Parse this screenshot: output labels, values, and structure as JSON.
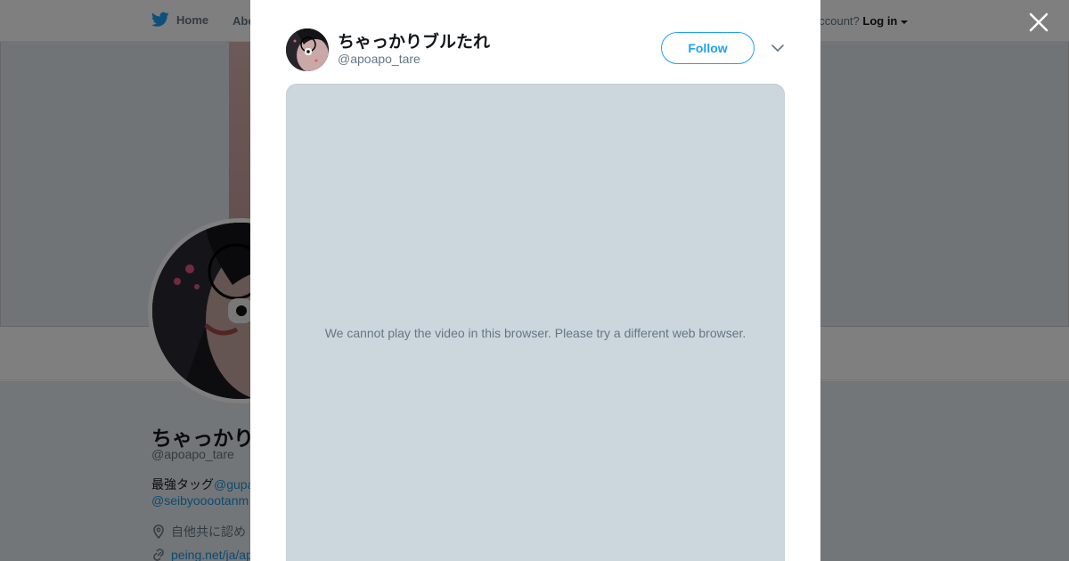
{
  "topbar": {
    "home_label": "Home",
    "about_label": "Abo",
    "login_prefix": "account?",
    "login_label": "Log in"
  },
  "profile": {
    "name": "ちゃっかり",
    "handle": "@apoapo_tare",
    "bio_prefix": "最強タッグ",
    "bio_mention1": "@gupa",
    "bio_mention2": "@seibyooootanm",
    "location": "自他共に認め",
    "website": "peing.net/ja/ap"
  },
  "modal": {
    "name": "ちゃっかりブルたれ",
    "handle": "@apoapo_tare",
    "follow_label": "Follow",
    "video_message": "We cannot play the video in this browser. Please try a different web browser."
  },
  "colors": {
    "accent": "#1da1f2",
    "video_bg": "#ccd6dd",
    "secondary_text": "#657786"
  },
  "icons": [
    "twitter-bird-icon",
    "caret-down-icon",
    "close-icon",
    "chevron-down-icon",
    "location-pin-icon",
    "link-icon"
  ]
}
